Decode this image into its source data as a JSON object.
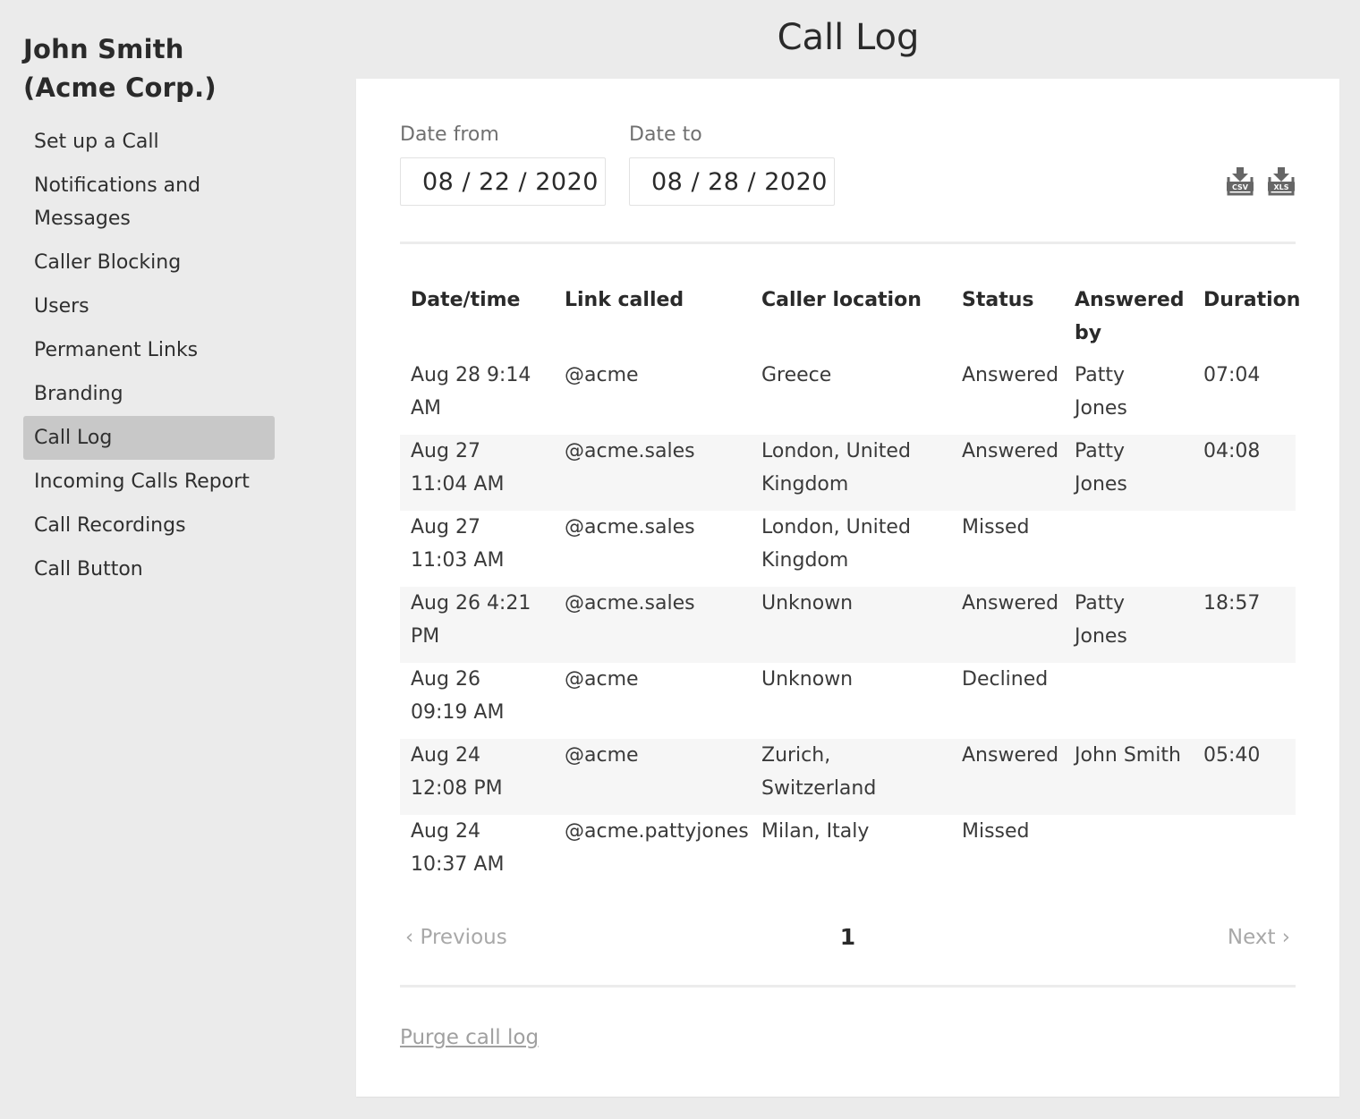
{
  "sidebar": {
    "account_name": "John Smith (Acme Corp.)",
    "items": [
      {
        "label": "Set up a Call",
        "active": false
      },
      {
        "label": "Notifications and Messages",
        "active": false
      },
      {
        "label": "Caller Blocking",
        "active": false
      },
      {
        "label": "Users",
        "active": false
      },
      {
        "label": "Permanent Links",
        "active": false
      },
      {
        "label": "Branding",
        "active": false
      },
      {
        "label": "Call Log",
        "active": true
      },
      {
        "label": "Incoming Calls Report",
        "active": false
      },
      {
        "label": "Call Recordings",
        "active": false
      },
      {
        "label": "Call Button",
        "active": false
      }
    ]
  },
  "header": {
    "title": "Call Log"
  },
  "filters": {
    "date_from_label": "Date from",
    "date_from_value": "08 / 22 / 2020",
    "date_to_label": "Date to",
    "date_to_value": "08 / 28 / 2020",
    "export": [
      {
        "label": "CSV",
        "icon": "download-csv-icon"
      },
      {
        "label": "XLS",
        "icon": "download-xls-icon"
      }
    ]
  },
  "table": {
    "columns": [
      "Date/time",
      "Link called",
      "Caller location",
      "Status",
      "Answered by",
      "Duration"
    ],
    "rows": [
      [
        "Aug 28 9:14 AM",
        "@acme",
        "Greece",
        "Answered",
        "Patty Jones",
        "07:04"
      ],
      [
        "Aug 27 11:04 AM",
        "@acme.sales",
        "London, United Kingdom",
        "Answered",
        "Patty Jones",
        "04:08"
      ],
      [
        "Aug 27 11:03 AM",
        "@acme.sales",
        "London, United Kingdom",
        "Missed",
        "",
        ""
      ],
      [
        "Aug 26 4:21 PM",
        "@acme.sales",
        "Unknown",
        "Answered",
        "Patty Jones",
        "18:57"
      ],
      [
        "Aug 26 09:19 AM",
        "@acme",
        "Unknown",
        "Declined",
        "",
        ""
      ],
      [
        "Aug 24 12:08 PM",
        "@acme",
        "Zurich, Switzerland",
        "Answered",
        "John Smith",
        "05:40"
      ],
      [
        "Aug 24 10:37 AM",
        "@acme.pattyjones",
        "Milan, Italy",
        "Missed",
        "",
        ""
      ]
    ]
  },
  "pagination": {
    "previous_label": "‹ Previous",
    "current_page": "1",
    "next_label": "Next ›"
  },
  "footer": {
    "purge_label": "Purge call log"
  },
  "colors": {
    "background": "#ebebeb",
    "panel": "#ffffff",
    "active_nav": "#c8c8c8",
    "row_stripe": "#f6f6f6",
    "muted_text": "#a8a8a8",
    "icon": "#666666"
  }
}
